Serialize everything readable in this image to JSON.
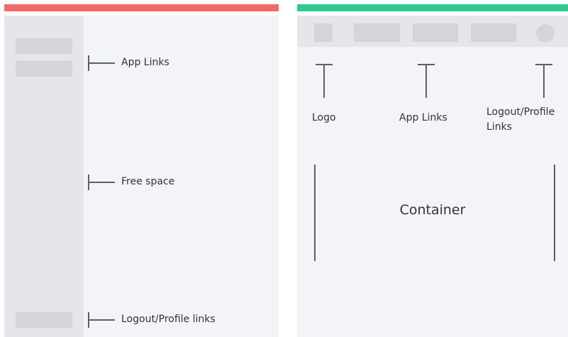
{
  "colors": {
    "left_accent": "#f06b68",
    "right_accent": "#2dc98f",
    "panel_background": "#f3f4f7",
    "sidebar_background": "#e5e6ea",
    "placeholder_block": "#d3d5db",
    "line": "#5a5f6b"
  },
  "sidebar_layout": {
    "labels": {
      "app_links": "App Links",
      "free_space": "Free space",
      "logout": "Logout/Profile links"
    }
  },
  "topnav_layout": {
    "labels": {
      "logo": "Logo",
      "app_links": "App Links",
      "logout_line1": "Logout/Profile",
      "logout_line2": "Links",
      "container": "Container"
    }
  }
}
